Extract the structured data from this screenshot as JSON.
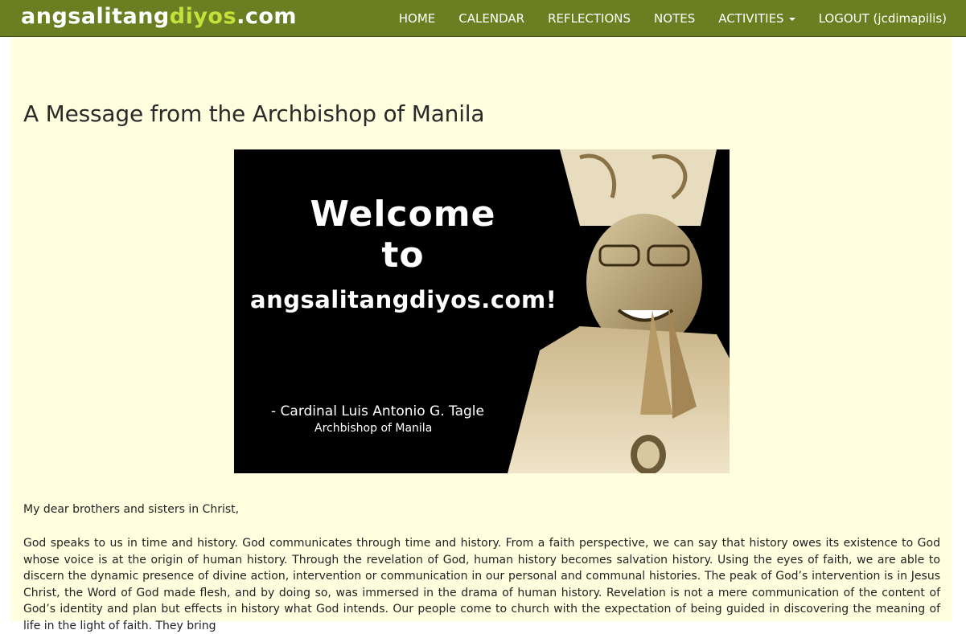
{
  "navbar": {
    "brand_part1": "angsalitang",
    "brand_part2": "diyos",
    "brand_part3": ".com",
    "items": [
      {
        "label": "HOME"
      },
      {
        "label": "CALENDAR"
      },
      {
        "label": "REFLECTIONS"
      },
      {
        "label": "NOTES"
      },
      {
        "label": "ACTIVITIES"
      },
      {
        "label": "LOGOUT (jcdimapilis)"
      }
    ]
  },
  "page": {
    "title": "A Message from the Archbishop of Manila",
    "banner": {
      "welcome": "Welcome to",
      "site": "angsalitangdiyos.com!",
      "signature": "- Cardinal Luis Antonio G. Tagle",
      "signature_title": "Archbishop of Manila"
    },
    "salutation": "My dear brothers and sisters in Christ,",
    "paragraph": "God speaks to us in time and history. God communicates through time and history. From a faith perspective, we can say that history owes its existence to God whose voice is at the origin of human history. Through the revelation of God, human history becomes salvation history. Using the eyes of faith, we are able to discern the dynamic presence of divine action, intervention or communication in our personal and communal histories. The peak of God’s intervention is in Jesus Christ, the Word of God made flesh, and by doing so, was immersed in the drama of human history. Revelation is not a mere communication of the content of God’s identity and plan but effects in history what God intends. Our people come to church with the expectation of being guided in discovering the meaning of life in the light of faith. They bring"
  },
  "colors": {
    "navbar": "#6b7f22",
    "brand_accent": "#c5e03a",
    "content_bg": "#ffffe0"
  }
}
